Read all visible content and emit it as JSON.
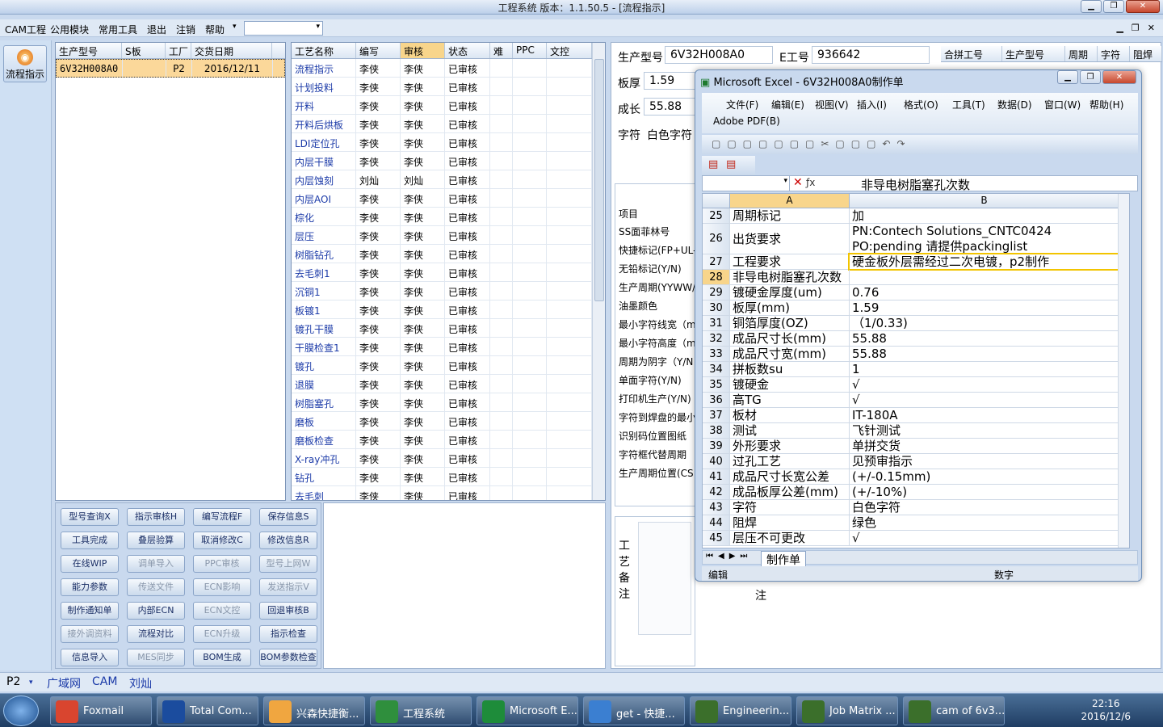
{
  "app": {
    "title": "工程系统    版本：1.1.50.5 - [流程指示]"
  },
  "menu": {
    "items": [
      "CAM工程",
      "公用模块",
      "常用工具",
      "退出",
      "注销",
      "帮助"
    ]
  },
  "left": {
    "flow_label": "流程指示"
  },
  "orders": {
    "columns": [
      "生产型号",
      "S板",
      "工厂",
      "交货日期"
    ],
    "rows": [
      [
        "6V32H008A0",
        "",
        "P2",
        "2016/12/11"
      ]
    ]
  },
  "process": {
    "columns": [
      "工艺名称",
      "编写",
      "审核",
      "状态",
      "难",
      "PPC",
      "文控"
    ],
    "rows": [
      [
        "流程指示",
        "李侠",
        "李侠",
        "已审核"
      ],
      [
        "计划投料",
        "李侠",
        "李侠",
        "已审核"
      ],
      [
        "开料",
        "李侠",
        "李侠",
        "已审核"
      ],
      [
        "开料后烘板",
        "李侠",
        "李侠",
        "已审核"
      ],
      [
        "LDI定位孔",
        "李侠",
        "李侠",
        "已审核"
      ],
      [
        "内层干膜",
        "李侠",
        "李侠",
        "已审核"
      ],
      [
        "内层蚀刻",
        "刘灿",
        "刘灿",
        "已审核"
      ],
      [
        "内层AOI",
        "李侠",
        "李侠",
        "已审核"
      ],
      [
        "棕化",
        "李侠",
        "李侠",
        "已审核"
      ],
      [
        "层压",
        "李侠",
        "李侠",
        "已审核"
      ],
      [
        "树脂钻孔",
        "李侠",
        "李侠",
        "已审核"
      ],
      [
        "去毛刺1",
        "李侠",
        "李侠",
        "已审核"
      ],
      [
        "沉铜1",
        "李侠",
        "李侠",
        "已审核"
      ],
      [
        "板镀1",
        "李侠",
        "李侠",
        "已审核"
      ],
      [
        "镀孔干膜",
        "李侠",
        "李侠",
        "已审核"
      ],
      [
        "干膜检查1",
        "李侠",
        "李侠",
        "已审核"
      ],
      [
        "镀孔",
        "李侠",
        "李侠",
        "已审核"
      ],
      [
        "退膜",
        "李侠",
        "李侠",
        "已审核"
      ],
      [
        "树脂塞孔",
        "李侠",
        "李侠",
        "已审核"
      ],
      [
        "磨板",
        "李侠",
        "李侠",
        "已审核"
      ],
      [
        "磨板检查",
        "李侠",
        "李侠",
        "已审核"
      ],
      [
        "X-ray冲孔",
        "李侠",
        "李侠",
        "已审核"
      ],
      [
        "钻孔",
        "李侠",
        "李侠",
        "已审核"
      ],
      [
        "去毛刺",
        "李侠",
        "李侠",
        "已审核"
      ]
    ]
  },
  "buttons": [
    [
      "型号查询X",
      "指示审核H",
      "编写流程F",
      "保存信息S"
    ],
    [
      "工具完成",
      "叠层验算",
      "取消修改C",
      "修改信息R"
    ],
    [
      "在线WIP",
      "调单导入",
      "PPC审核",
      "型号上网W"
    ],
    [
      "能力参数",
      "传送文件",
      "ECN影响",
      "发送指示V"
    ],
    [
      "制作通知单",
      "内部ECN",
      "ECN文控",
      "回退审核B"
    ],
    [
      "接外调资料",
      "流程对比",
      "ECN升级",
      "指示检查"
    ],
    [
      "信息导入",
      "MES同步",
      "BOM生成",
      "BOM参数检查"
    ]
  ],
  "info": {
    "model_label": "生产型号",
    "model": "6V32H008A0",
    "eno_label": "E工号",
    "eno": "936642",
    "thick_label": "板厚",
    "thick": "1.59",
    "len_label": "成长",
    "len": "55.88",
    "char_label": "字符",
    "char": "白色字符",
    "combine_cols": [
      "合拼工号",
      "生产型号",
      "周期",
      "字符",
      "阻焊"
    ],
    "list_header": "项目",
    "labels": [
      "SS面菲林号",
      "快捷标记(FP+UL-",
      "无铅标记(Y/N)",
      "生产周期(YYWW/",
      "油墨颜色",
      "最小字符线宽（m",
      "最小字符高度（m",
      "周期为阴字（Y/N",
      "单面字符(Y/N)",
      "打印机生产(Y/N)",
      "字符到焊盘的最小",
      "识别码位置图纸",
      "字符框代替周期",
      "生产周期位置(CS"
    ],
    "remark_label": "工艺备注",
    "note_label": "注"
  },
  "status": {
    "p2": "P2",
    "net": "广域网",
    "cam": "CAM",
    "user": "刘灿"
  },
  "taskbar": {
    "items": [
      "Foxmail",
      "Total Com...",
      "兴森快捷衡...",
      "工程系统",
      "Microsoft E...",
      "get - 快捷...",
      "Engineerin...",
      "Job Matrix ...",
      "cam of 6v3..."
    ],
    "time": "22:16",
    "date": "2016/12/6"
  },
  "excel": {
    "title": "Microsoft Excel - 6V32H008A0制作单",
    "menus": [
      "文件(F)",
      "编辑(E)",
      "视图(V)",
      "插入(I)",
      "格式(O)",
      "工具(T)",
      "数据(D)",
      "窗口(W)",
      "帮助(H)"
    ],
    "menu2": "Adobe PDF(B)",
    "formula": "非导电树脂塞孔次数",
    "cols": [
      "A",
      "B"
    ],
    "rows": [
      [
        "25",
        "周期标记",
        "加"
      ],
      [
        "26",
        "出货要求",
        "PN:Contech Solutions_CNTC0424 PO:pending 请提供packinglist"
      ],
      [
        "27",
        "工程要求",
        "硬金板外层需经过二次电镀，p2制作"
      ],
      [
        "28",
        "非导电树脂塞孔次数",
        ""
      ],
      [
        "29",
        "镀硬金厚度(um)",
        "0.76"
      ],
      [
        "30",
        "板厚(mm)",
        "1.59"
      ],
      [
        "31",
        "铜箔厚度(OZ)",
        "（1/0.33)"
      ],
      [
        "32",
        "成品尺寸长(mm)",
        "55.88"
      ],
      [
        "33",
        "成品尺寸宽(mm)",
        "55.88"
      ],
      [
        "34",
        "拼板数su",
        "1"
      ],
      [
        "35",
        "镀硬金",
        "√"
      ],
      [
        "36",
        "高TG",
        "√"
      ],
      [
        "37",
        "板材",
        "IT-180A"
      ],
      [
        "38",
        "测试",
        "飞针测试"
      ],
      [
        "39",
        "外形要求",
        "单拼交货"
      ],
      [
        "40",
        "过孔工艺",
        "见预审指示"
      ],
      [
        "41",
        "成品尺寸长宽公差",
        "(+/-0.15mm)"
      ],
      [
        "42",
        "成品板厚公差(mm)",
        "(+/-10%)"
      ],
      [
        "43",
        "字符",
        "白色字符"
      ],
      [
        "44",
        "阻焊",
        "绿色"
      ],
      [
        "45",
        "层压不可更改",
        "√"
      ]
    ],
    "sheet_tab": "制作单",
    "status_left": "编辑",
    "status_right": "数字"
  }
}
